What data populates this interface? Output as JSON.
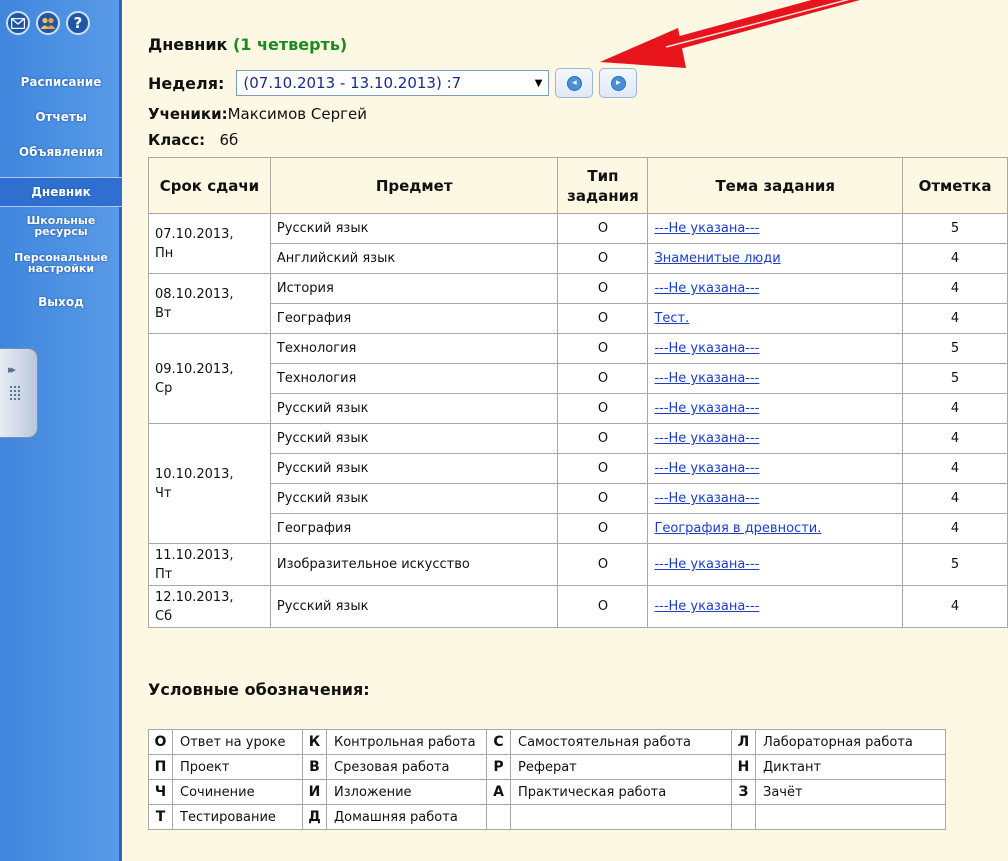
{
  "sidebar": {
    "icons": [
      "mail-icon",
      "users-icon",
      "help-icon"
    ],
    "help_glyph": "?",
    "items": [
      {
        "label": "Расписание"
      },
      {
        "label": "Отчеты"
      },
      {
        "label": "Объявления"
      },
      {
        "label": "Дневник",
        "active": true
      },
      {
        "label": "Школьные ресурсы",
        "line1": "Школьные",
        "line2": "ресурсы"
      },
      {
        "label": "Персональные настройки",
        "line1": "Персональные",
        "line2": "настройки"
      },
      {
        "label": "Выход"
      }
    ],
    "toggle_arrows": "▸▸"
  },
  "header": {
    "title_main": "Дневник",
    "title_quarter": "(1 четверть)",
    "week_label": "Неделя:",
    "week_value": "(07.10.2013 - 13.10.2013) :7",
    "prev_icon": "arrow-left-icon",
    "next_icon": "arrow-right-icon",
    "students_label": "Ученики:",
    "students_value": "Максимов Сергей",
    "class_label": "Класс:",
    "class_value": "6б"
  },
  "diary": {
    "columns": [
      "Срок сдачи",
      "Предмет",
      "Тип задания",
      "Тема задания",
      "Отметка"
    ],
    "type_col_l1": "Тип",
    "type_col_l2": "задания",
    "days": [
      {
        "date": "07.10.2013,",
        "weekday": "Пн",
        "rows": [
          {
            "subject": "Русский язык",
            "type": "О",
            "topic": "---Не указана---",
            "mark": "5"
          },
          {
            "subject": "Английский язык",
            "type": "О",
            "topic": "Знаменитые люди",
            "mark": "4"
          }
        ]
      },
      {
        "date": "08.10.2013,",
        "weekday": "Вт",
        "rows": [
          {
            "subject": "История",
            "type": "О",
            "topic": "---Не указана---",
            "mark": "4"
          },
          {
            "subject": "География",
            "type": "О",
            "topic": "Тест.",
            "mark": "4"
          }
        ]
      },
      {
        "date": "09.10.2013,",
        "weekday": "Ср",
        "rows": [
          {
            "subject": "Технология",
            "type": "О",
            "topic": "---Не указана---",
            "mark": "5"
          },
          {
            "subject": "Технология",
            "type": "О",
            "topic": "---Не указана---",
            "mark": "5"
          },
          {
            "subject": "Русский язык",
            "type": "О",
            "topic": "---Не указана---",
            "mark": "4"
          }
        ]
      },
      {
        "date": "10.10.2013,",
        "weekday": "Чт",
        "rows": [
          {
            "subject": "Русский язык",
            "type": "О",
            "topic": "---Не указана---",
            "mark": "4"
          },
          {
            "subject": "Русский язык",
            "type": "О",
            "topic": "---Не указана---",
            "mark": "4"
          },
          {
            "subject": "Русский язык",
            "type": "О",
            "topic": "---Не указана---",
            "mark": "4"
          },
          {
            "subject": "География",
            "type": "О",
            "topic": "География в древности.",
            "mark": "4"
          }
        ]
      },
      {
        "date": "11.10.2013,",
        "weekday": "Пт",
        "tall": true,
        "rows": [
          {
            "subject": "Изобразительное искусство",
            "type": "О",
            "topic": "---Не указана---",
            "mark": "5"
          }
        ]
      },
      {
        "date": "12.10.2013,",
        "weekday": "Сб",
        "tall": true,
        "rows": [
          {
            "subject": "Русский язык",
            "type": "О",
            "topic": "---Не указана---",
            "mark": "4"
          }
        ]
      }
    ]
  },
  "legend": {
    "title": "Условные обозначения:",
    "rows": [
      [
        [
          "О",
          "Ответ на уроке"
        ],
        [
          "К",
          "Контрольная работа"
        ],
        [
          "С",
          "Самостоятельная работа"
        ],
        [
          "Л",
          "Лабораторная работа"
        ]
      ],
      [
        [
          "П",
          "Проект"
        ],
        [
          "В",
          "Срезовая работа"
        ],
        [
          "Р",
          "Реферат"
        ],
        [
          "Н",
          "Диктант"
        ]
      ],
      [
        [
          "Ч",
          "Сочинение"
        ],
        [
          "И",
          "Изложение"
        ],
        [
          "А",
          "Практическая работа"
        ],
        [
          "З",
          "Зачёт"
        ]
      ],
      [
        [
          "Т",
          "Тестирование"
        ],
        [
          "Д",
          "Домашняя работа"
        ],
        [
          "",
          ""
        ],
        [
          "",
          ""
        ]
      ]
    ]
  },
  "colors": {
    "sidebar": "#4a90e2",
    "background": "#fdf8e4",
    "quarter_green": "#1c8a1c",
    "link_blue": "#1a3ec9",
    "arrow_red": "#e8141c"
  }
}
